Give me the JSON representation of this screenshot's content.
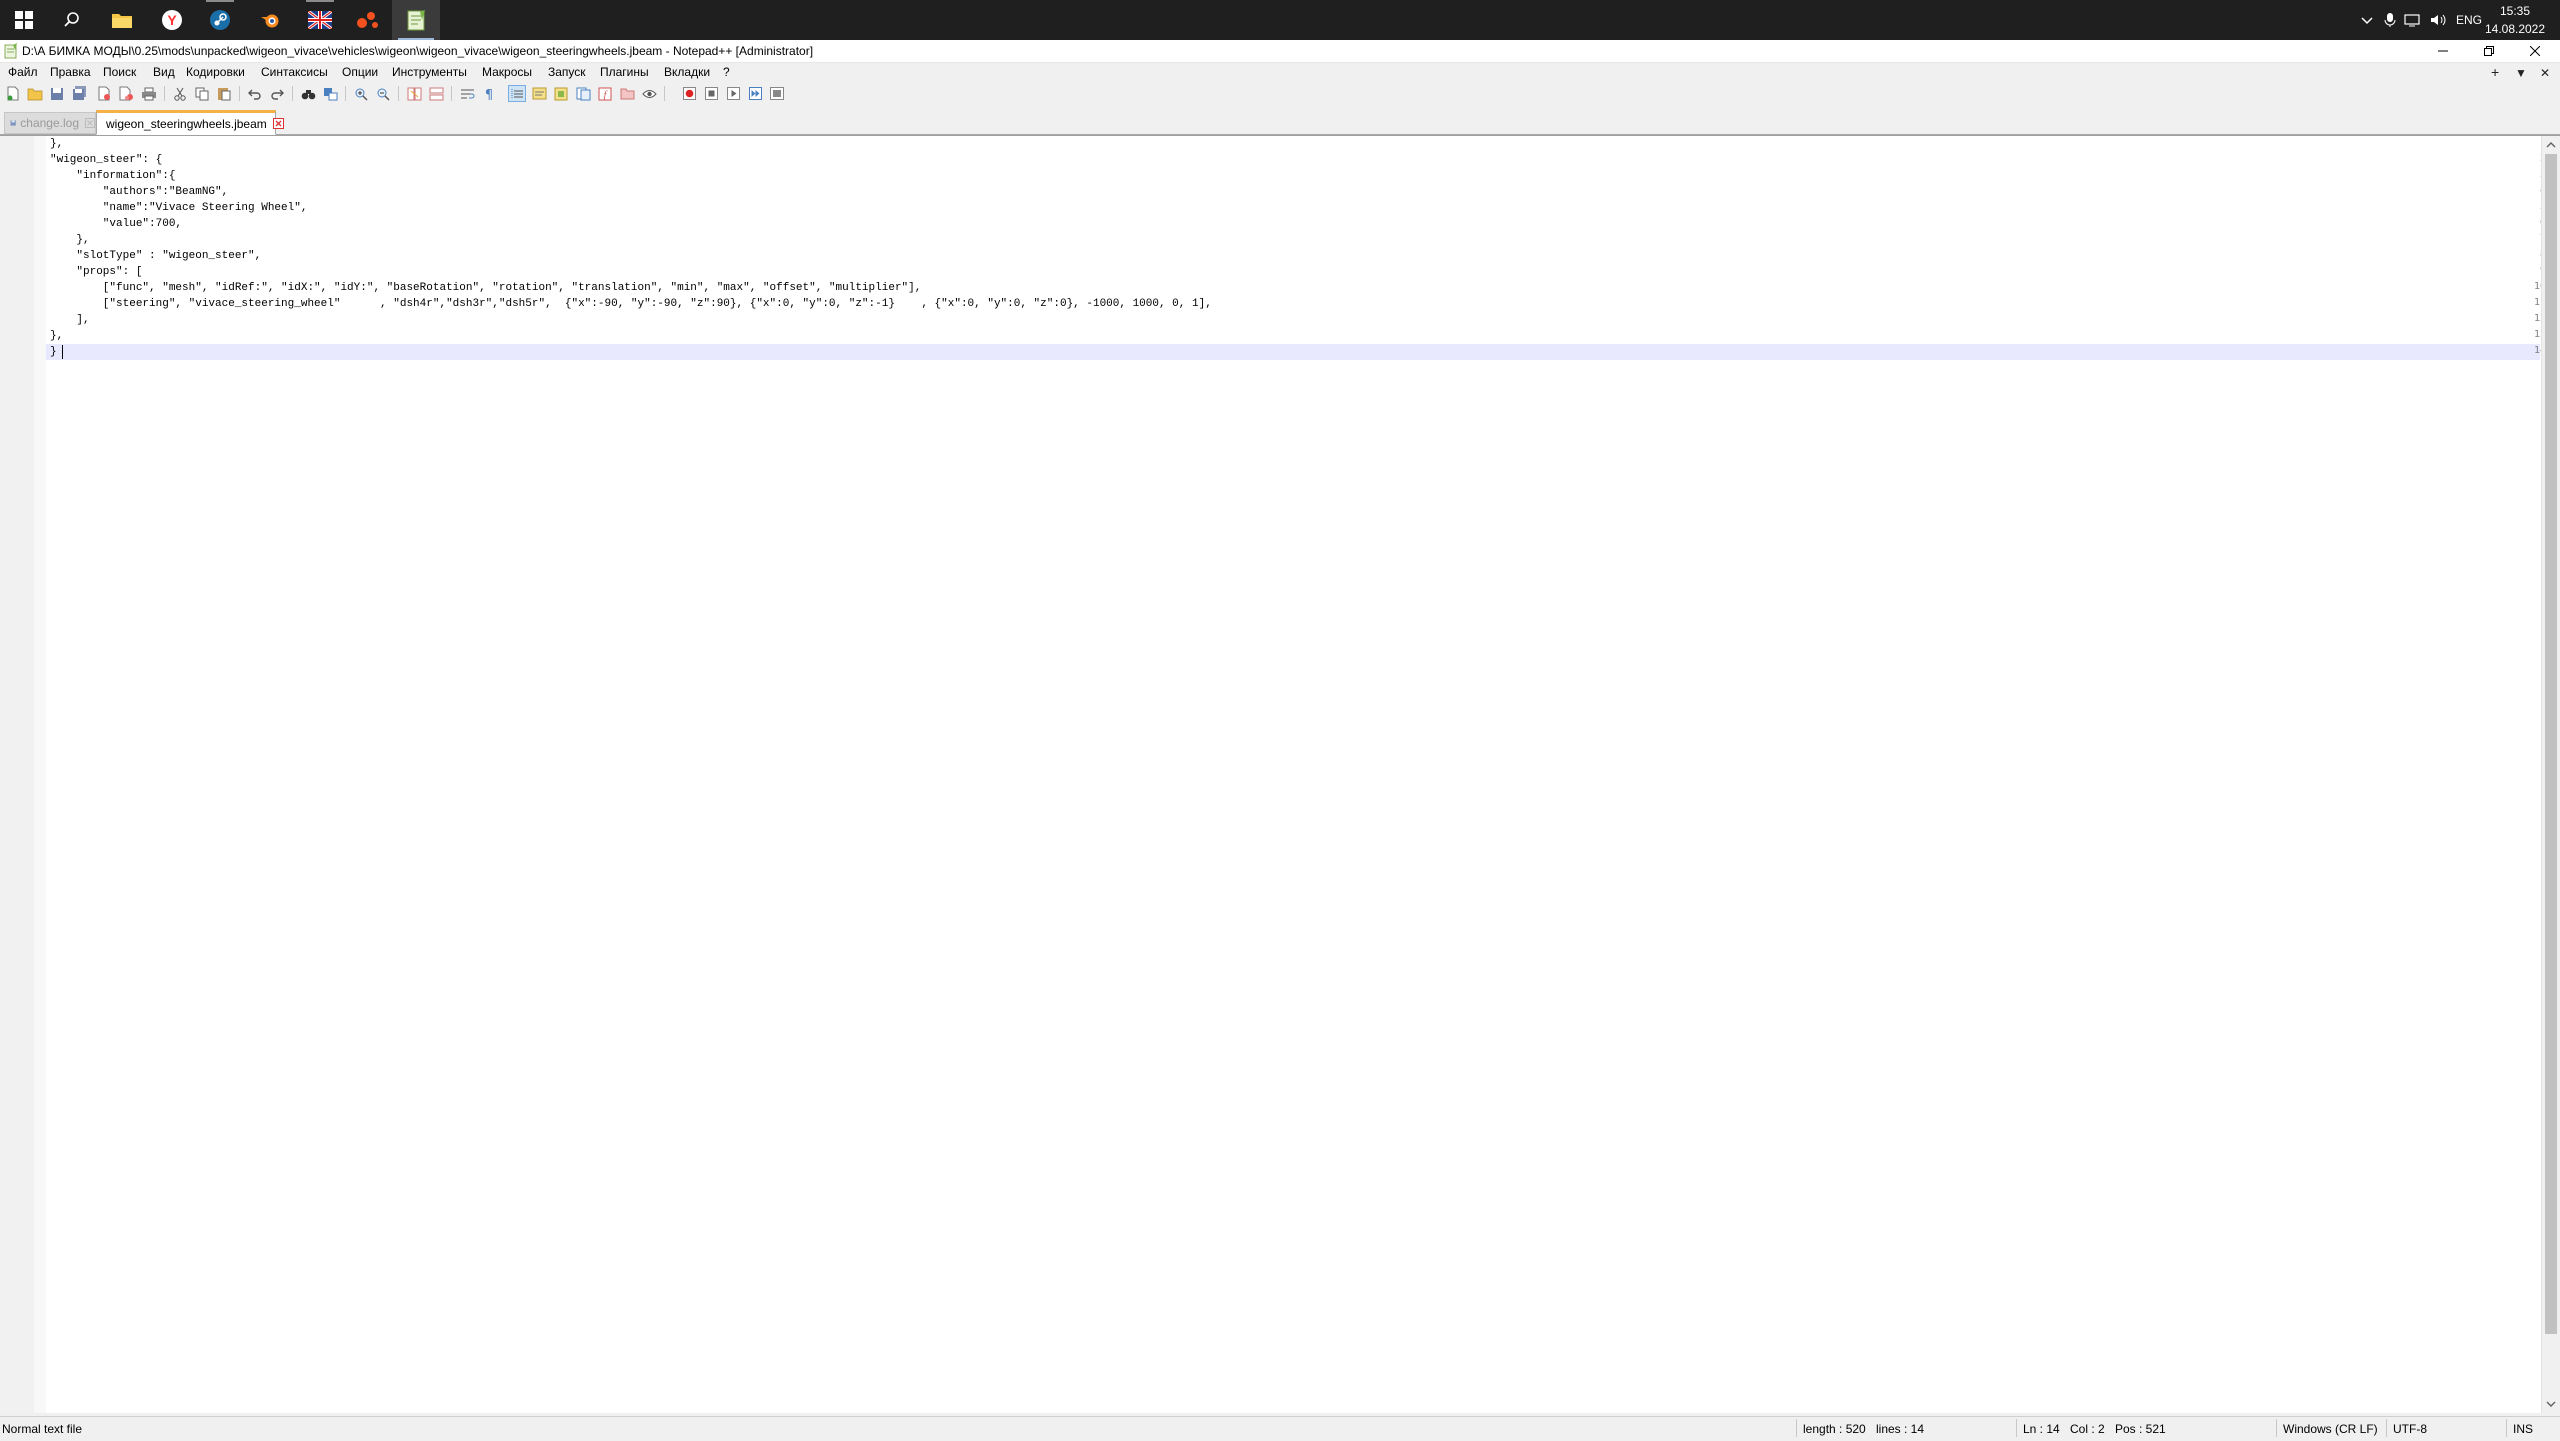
{
  "taskbar": {
    "apps": [
      {
        "name": "windows-start",
        "icon": "windows-logo-icon"
      },
      {
        "name": "search",
        "icon": "search-icon"
      },
      {
        "name": "file-explorer",
        "icon": "folder-icon"
      },
      {
        "name": "yandex-browser",
        "icon": "yandex-icon"
      },
      {
        "name": "steam",
        "icon": "steam-icon"
      },
      {
        "name": "blender",
        "icon": "blender-icon"
      },
      {
        "name": "flag-app",
        "icon": "flag-icon"
      },
      {
        "name": "media-app",
        "icon": "dots-icon"
      },
      {
        "name": "notepad-plus-plus",
        "icon": "notepad-icon"
      }
    ],
    "tray": {
      "language": "ENG"
    },
    "clock": {
      "time": "15:35",
      "date": "14.08.2022"
    }
  },
  "window": {
    "title": "D:\\А БИМКА МОДЫ\\0.25\\mods\\unpacked\\wigeon_vivace\\vehicles\\wigeon\\wigeon_vivace\\wigeon_steeringwheels.jbeam - Notepad++ [Administrator]"
  },
  "menu": {
    "items": [
      "Файл",
      "Правка",
      "Поиск",
      "Вид",
      "Кодировки",
      "Синтаксисы",
      "Опции",
      "Инструменты",
      "Макросы",
      "Запуск",
      "Плагины",
      "Вкладки",
      "?"
    ],
    "right_controls": [
      "+",
      "▼",
      "✕"
    ]
  },
  "tabs": [
    {
      "label": "change.log",
      "active": false
    },
    {
      "label": "wigeon_steeringwheels.jbeam",
      "active": true
    }
  ],
  "editor": {
    "lines": [
      "},",
      "\"wigeon_steer\": {",
      "    \"information\":{",
      "        \"authors\":\"BeamNG\",",
      "        \"name\":\"Vivace Steering Wheel\",",
      "        \"value\":700,",
      "    },",
      "    \"slotType\" : \"wigeon_steer\",",
      "    \"props\": [",
      "        [\"func\", \"mesh\", \"idRef:\", \"idX:\", \"idY:\", \"baseRotation\", \"rotation\", \"translation\", \"min\", \"max\", \"offset\", \"multiplier\"],",
      "        [\"steering\", \"vivace_steering_wheel\"      , \"dsh4r\",\"dsh3r\",\"dsh5r\",  {\"x\":-90, \"y\":-90, \"z\":90}, {\"x\":0, \"y\":0, \"z\":-1}    , {\"x\":0, \"y\":0, \"z\":0}, -1000, 1000, 0, 1],",
      "    ],",
      "},",
      "}"
    ],
    "current_line": 14
  },
  "status": {
    "file_type": "Normal text file",
    "length": "length : 520",
    "lines": "lines : 14",
    "ln": "Ln : 14",
    "col": "Col : 2",
    "pos": "Pos : 521",
    "eol": "Windows (CR LF)",
    "encoding": "UTF-8",
    "mode": "INS"
  }
}
